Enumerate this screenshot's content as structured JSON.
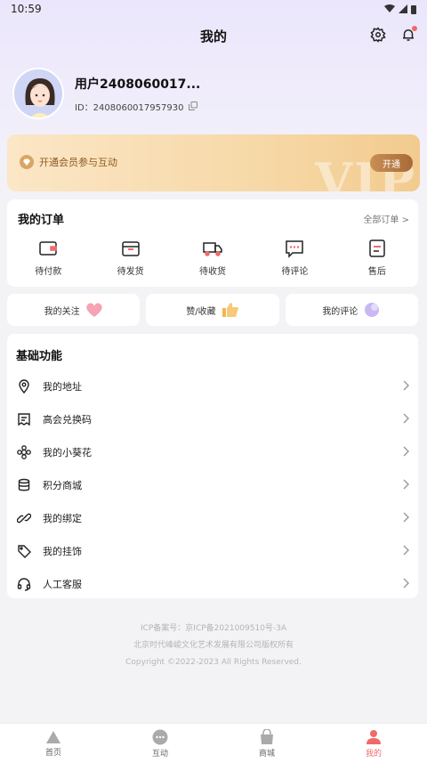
{
  "status": {
    "time": "10:59"
  },
  "header": {
    "title": "我的"
  },
  "profile": {
    "username": "用户2408060017...",
    "id_label": "ID：2408060017957930"
  },
  "vip": {
    "text": "开通会员参与互动",
    "button": "开通",
    "watermark": "VIP"
  },
  "orders": {
    "title": "我的订单",
    "all": "全部订单 >",
    "items": [
      {
        "label": "待付款",
        "icon": "wallet-icon"
      },
      {
        "label": "待发货",
        "icon": "package-icon"
      },
      {
        "label": "待收货",
        "icon": "truck-icon"
      },
      {
        "label": "待评论",
        "icon": "comment-icon"
      },
      {
        "label": "售后",
        "icon": "after-sales-icon"
      }
    ]
  },
  "quick": [
    {
      "label": "我的关注",
      "icon": "heart-icon"
    },
    {
      "label": "赞/收藏",
      "icon": "thumbs-up-icon"
    },
    {
      "label": "我的评论",
      "icon": "chat-bubble-icon"
    }
  ],
  "basic": {
    "title": "基础功能",
    "items": [
      {
        "label": "我的地址",
        "icon": "location-icon"
      },
      {
        "label": "高会兑换码",
        "icon": "coupon-icon"
      },
      {
        "label": "我的小葵花",
        "icon": "flower-icon"
      },
      {
        "label": "积分商城",
        "icon": "coins-icon"
      },
      {
        "label": "我的绑定",
        "icon": "link-icon"
      },
      {
        "label": "我的挂饰",
        "icon": "tag-icon"
      },
      {
        "label": "人工客服",
        "icon": "headset-icon"
      }
    ]
  },
  "footer": {
    "icp": "ICP备案号：京ICP备2021009510号-3A",
    "company": "北京时代峰峻文化艺术发展有限公司版权所有",
    "copyright": "Copyright ©2022-2023 All Rights Reserved."
  },
  "tabs": [
    {
      "label": "首页",
      "icon": "home-icon"
    },
    {
      "label": "互动",
      "icon": "interact-icon"
    },
    {
      "label": "商城",
      "icon": "shop-bag-icon"
    },
    {
      "label": "我的",
      "icon": "profile-icon",
      "active": true
    }
  ],
  "colors": {
    "accent": "#ef6a6a",
    "vip_text": "#8c5a22"
  }
}
